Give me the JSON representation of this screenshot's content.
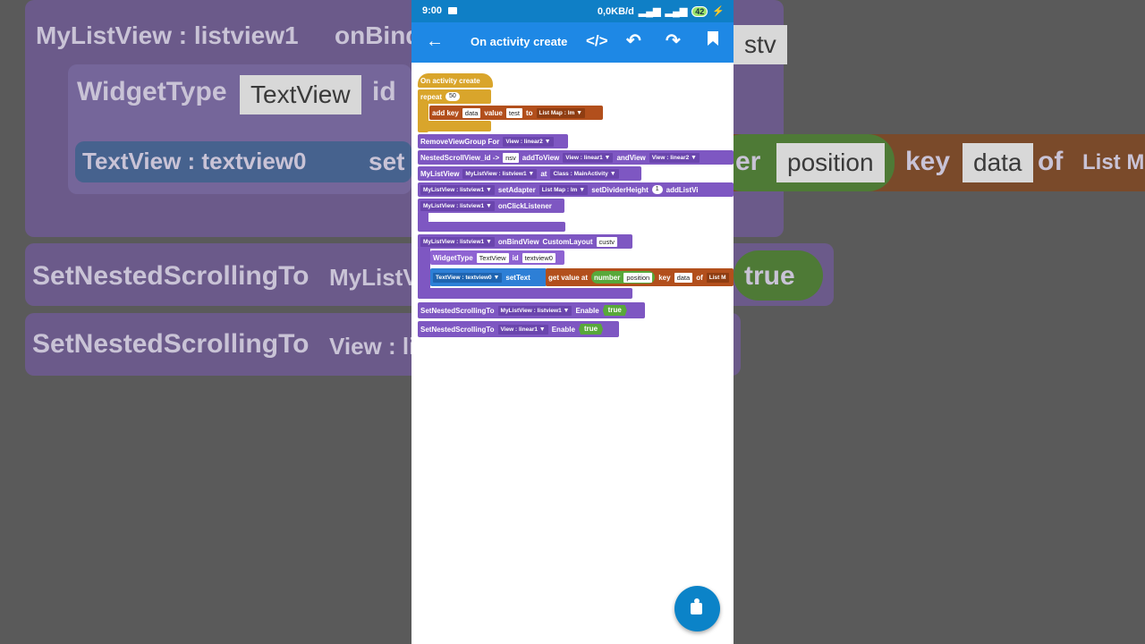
{
  "status_bar": {
    "time": "9:00",
    "net_speed": "0,0KB/d",
    "battery": "42"
  },
  "app_bar": {
    "title": "On activity create",
    "back_icon": "arrow-left-icon",
    "code_icon": "code-icon",
    "undo_icon": "undo-icon",
    "redo_icon": "redo-icon",
    "bookmark_icon": "bookmark-icon"
  },
  "blocks": {
    "event": "On activity create",
    "repeat_label": "repeat",
    "repeat_count": "50",
    "add_key": "add key",
    "add_key_value": "data",
    "value_label": "value",
    "value_value": "test",
    "to_label": "to",
    "listmap_label": "List Map :",
    "listmap_value": "lm",
    "remove_label": "RemoveViewGroup For",
    "view_linear2": "View : linear2",
    "nested_label": "NestedScrollView_id ->",
    "nsv": "nsv",
    "add_to_view": "addToView",
    "view_linear1": "View : linear1",
    "and_view": "andView",
    "mylistview_label": "MyListView",
    "mlv_listview1": "MyListView : listview1",
    "at_label": "at",
    "class_main": "Class : MainActivity",
    "set_adapter": "setAdapter",
    "listmap_lm": "List Map : lm",
    "set_divider": "setDividerHeight",
    "divider_value": "1",
    "add_list_view": "addListVi",
    "on_click": "onClickListener",
    "on_bind": "onBindView",
    "custom_layout": "CustomLayout",
    "custom_value": "custv",
    "widget_type": "WidgetType",
    "widget_value": "TextView",
    "id_label": "id",
    "id_value": "textview0",
    "tv_textview0": "TextView : textview0",
    "set_text": "setText",
    "get_value": "get value at",
    "number_label": "number",
    "position": "position",
    "key_label": "key",
    "key_value": "data",
    "of_label": "of",
    "listm": "List M",
    "set_nested": "SetNestedScrollingTo",
    "enable": "Enable",
    "true_value": "true"
  },
  "background": {
    "mlv": "MyListView : listview1",
    "onbind": "onBind",
    "widget": "WidgetType",
    "textview": "TextView",
    "id": "id",
    "tv_textview0": "TextView : textview0",
    "set": "set",
    "er": "er",
    "position": "position",
    "key": "key",
    "data": "data",
    "of": "of",
    "list_m": "List M",
    "stv": "stv",
    "set_nested": "SetNestedScrollingTo",
    "mylistv": "MyListV",
    "view_li": "View : li",
    "true": "true"
  },
  "fab_icon": "puzzle-piece-icon"
}
